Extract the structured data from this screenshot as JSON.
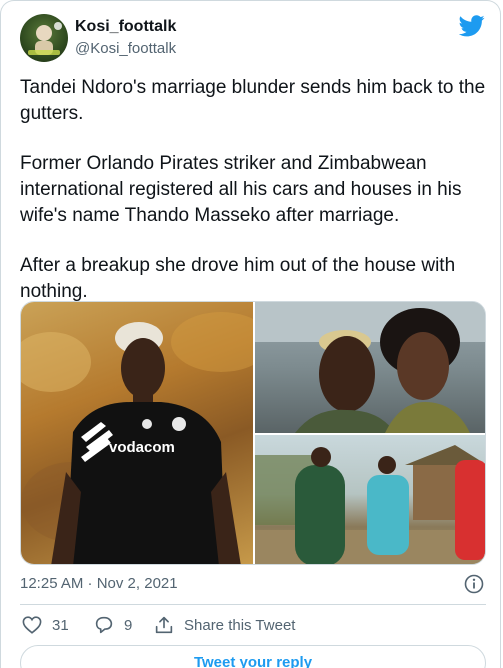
{
  "author": {
    "display_name": "Kosi_foottalk",
    "handle": "@Kosi_foottalk"
  },
  "tweet": {
    "paragraphs": [
      "Tandei Ndoro's marriage blunder sends him back to the gutters.",
      "Former Orlando Pirates striker and Zimbabwean international registered all his cars and houses in his wife's name Thando Masseko after marriage.",
      "After a breakup she drove him out of the house with nothing."
    ],
    "timestamp": "12:25 AM · Nov 2, 2021"
  },
  "media": {
    "left_jersey_text": "vodacom"
  },
  "actions": {
    "like_count": "31",
    "reply_count": "9",
    "share_label": "Share this Tweet"
  },
  "reply_button": {
    "label": "Tweet your reply"
  },
  "colors": {
    "brand_blue": "#1d9bf0",
    "text": "#0f1419",
    "muted": "#536471",
    "border": "#cfd9de"
  },
  "icons": [
    "twitter-bird-icon",
    "info-icon",
    "heart-icon",
    "reply-icon",
    "share-icon"
  ]
}
